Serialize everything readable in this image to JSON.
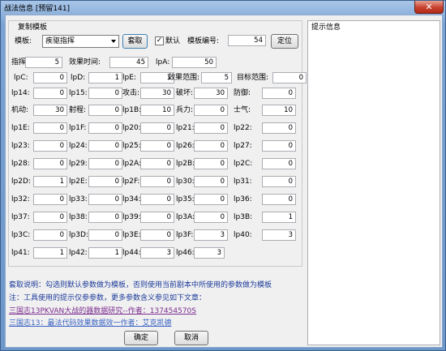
{
  "window": {
    "title": "战法信息 [预留141]",
    "close_glyph": "✕"
  },
  "group": {
    "label": "复制模板",
    "template_label": "模板:",
    "template_value": "疾驱指挥",
    "fetch_button": "套取",
    "default_label": "默认",
    "default_checked": true,
    "template_no_label": "模板编号:",
    "template_no_value": "54",
    "locate_button": "定位"
  },
  "hint_panel": {
    "title": "提示信息"
  },
  "fields": [
    {
      "label": "指挥:",
      "value": "5"
    },
    {
      "label": "效果时间:",
      "value": "45"
    },
    {
      "label": "lpA:",
      "value": "50"
    },
    {
      "label": "lpC:",
      "value": "0"
    },
    {
      "label": "lpD:",
      "value": "1"
    },
    {
      "label": "lpE:",
      "value": "1"
    },
    {
      "label": "效果范围:",
      "value": "5"
    },
    {
      "label": "目标范围:",
      "value": "0"
    },
    {
      "label": "lp14:",
      "value": "0"
    },
    {
      "label": "lp15:",
      "value": "0"
    },
    {
      "label": "攻击:",
      "value": "30"
    },
    {
      "label": "破坏:",
      "value": "30"
    },
    {
      "label": "防御:",
      "value": "0"
    },
    {
      "label": "机动:",
      "value": "30"
    },
    {
      "label": "射程:",
      "value": "0"
    },
    {
      "label": "lp1B:",
      "value": "10"
    },
    {
      "label": "兵力:",
      "value": "0"
    },
    {
      "label": "士气:",
      "value": "10"
    },
    {
      "label": "lp1E:",
      "value": "0"
    },
    {
      "label": "lp1F:",
      "value": "0"
    },
    {
      "label": "lp20:",
      "value": "0"
    },
    {
      "label": "lp21:",
      "value": "0"
    },
    {
      "label": "lp22:",
      "value": "0"
    },
    {
      "label": "lp23:",
      "value": "0"
    },
    {
      "label": "lp24:",
      "value": "0"
    },
    {
      "label": "lp25:",
      "value": "0"
    },
    {
      "label": "lp26:",
      "value": "0"
    },
    {
      "label": "lp27:",
      "value": "0"
    },
    {
      "label": "lp28:",
      "value": "0"
    },
    {
      "label": "lp29:",
      "value": "0"
    },
    {
      "label": "lp2A:",
      "value": "0"
    },
    {
      "label": "lp2B:",
      "value": "0"
    },
    {
      "label": "lp2C:",
      "value": "0"
    },
    {
      "label": "lp2D:",
      "value": "1"
    },
    {
      "label": "lp2E:",
      "value": "0"
    },
    {
      "label": "lp2F:",
      "value": "0"
    },
    {
      "label": "lp30:",
      "value": "0"
    },
    {
      "label": "lp31:",
      "value": "0"
    },
    {
      "label": "lp32:",
      "value": "0"
    },
    {
      "label": "lp33:",
      "value": "0"
    },
    {
      "label": "lp34:",
      "value": "0"
    },
    {
      "label": "lp35:",
      "value": "0"
    },
    {
      "label": "lp36:",
      "value": "0"
    },
    {
      "label": "lp37:",
      "value": "0"
    },
    {
      "label": "lp38:",
      "value": "0"
    },
    {
      "label": "lp39:",
      "value": "0"
    },
    {
      "label": "lp3A:",
      "value": "0"
    },
    {
      "label": "lp3B:",
      "value": "1"
    },
    {
      "label": "lp3C:",
      "value": "0"
    },
    {
      "label": "lp3D:",
      "value": "0"
    },
    {
      "label": "lp3E:",
      "value": "0"
    },
    {
      "label": "lp3F:",
      "value": "3"
    },
    {
      "label": "lp40:",
      "value": "3"
    },
    {
      "label": "lp41:",
      "value": "1"
    },
    {
      "label": "lp42:",
      "value": "1"
    },
    {
      "label": "lp44:",
      "value": "3"
    },
    {
      "label": "lp46:",
      "value": "3"
    }
  ],
  "notes": {
    "fetch_note": "套取说明：勾选则默认参数做为模板，否则使用当前剧本中所使用的参数做为模板",
    "tool_note": "注：工具使用的提示仅参参数，更多参数含义参见如下文章：",
    "link1": "三国志13PKVAN大战的器数据研究--作者：137454570S",
    "link2": "三国志13：最法代码效果数据效一作者：艾克凯德"
  },
  "buttons": {
    "ok": "确定",
    "cancel": "取消"
  }
}
